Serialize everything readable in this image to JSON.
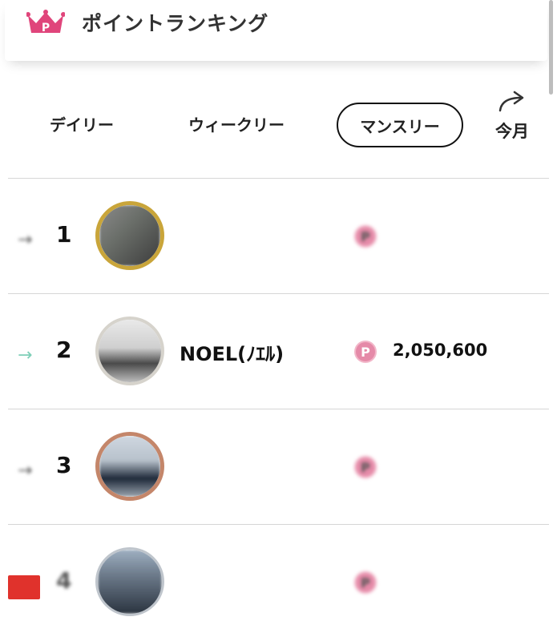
{
  "header": {
    "title": "ポイントランキング",
    "crown_badge": "P",
    "crown_color": "#e0457b"
  },
  "tabs": [
    {
      "label": "デイリー",
      "active": false
    },
    {
      "label": "ウィークリー",
      "active": false
    },
    {
      "label": "マンスリー",
      "active": true
    }
  ],
  "share": {
    "label": "今月",
    "icon": "share-arrow-icon"
  },
  "coin_icon_label": "P",
  "ranking": [
    {
      "rank": "1",
      "name": "",
      "points": "",
      "trend": "→",
      "blurred": true,
      "avatar_ring": "#c9a53a"
    },
    {
      "rank": "2",
      "name": "NOEL(ﾉｴﾙ)",
      "points": "2,050,600",
      "trend": "→",
      "blurred": false,
      "avatar_ring": "#d6d3cc"
    },
    {
      "rank": "3",
      "name": "",
      "points": "",
      "trend": "→",
      "blurred": true,
      "avatar_ring": "#c4866a"
    },
    {
      "rank": "4",
      "name": "",
      "points": "",
      "trend": "",
      "blurred": true,
      "avatar_ring": "#bfc5cc"
    }
  ],
  "colors": {
    "trend_arrow": "#7fcfb8",
    "coin": "#e58aa8",
    "divider": "#d6d6d6"
  }
}
